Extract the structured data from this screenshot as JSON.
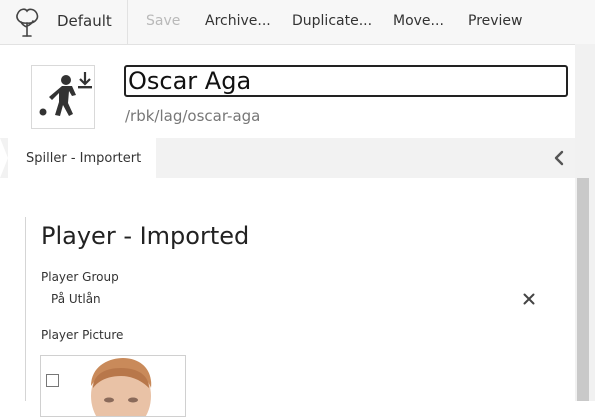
{
  "toolbar": {
    "logo_icon": "tree-logo-icon",
    "site_name": "Default",
    "actions": [
      {
        "label": "Save",
        "enabled": false
      },
      {
        "label": "Archive...",
        "enabled": true
      },
      {
        "label": "Duplicate...",
        "enabled": true
      },
      {
        "label": "Move...",
        "enabled": true
      },
      {
        "label": "Preview",
        "enabled": true
      }
    ]
  },
  "document": {
    "icon": "player-import-icon",
    "title": "Oscar Aga",
    "path": "/rbk/lag/oscar-aga"
  },
  "tabs": {
    "active": "Spiller - Importert",
    "collapse_icon": "chevron-left-icon"
  },
  "form": {
    "heading": "Player - Imported",
    "player_group": {
      "label": "Player Group",
      "value": "På Utlån",
      "remove_icon": "close-icon"
    },
    "player_picture": {
      "label": "Player Picture"
    }
  },
  "colors": {
    "toolbar_bg": "#f7f7f7",
    "disabled_text": "#b9b9b9",
    "tab_strip_bg": "#f2f2f2",
    "scroll_thumb": "#c9c9c9"
  }
}
